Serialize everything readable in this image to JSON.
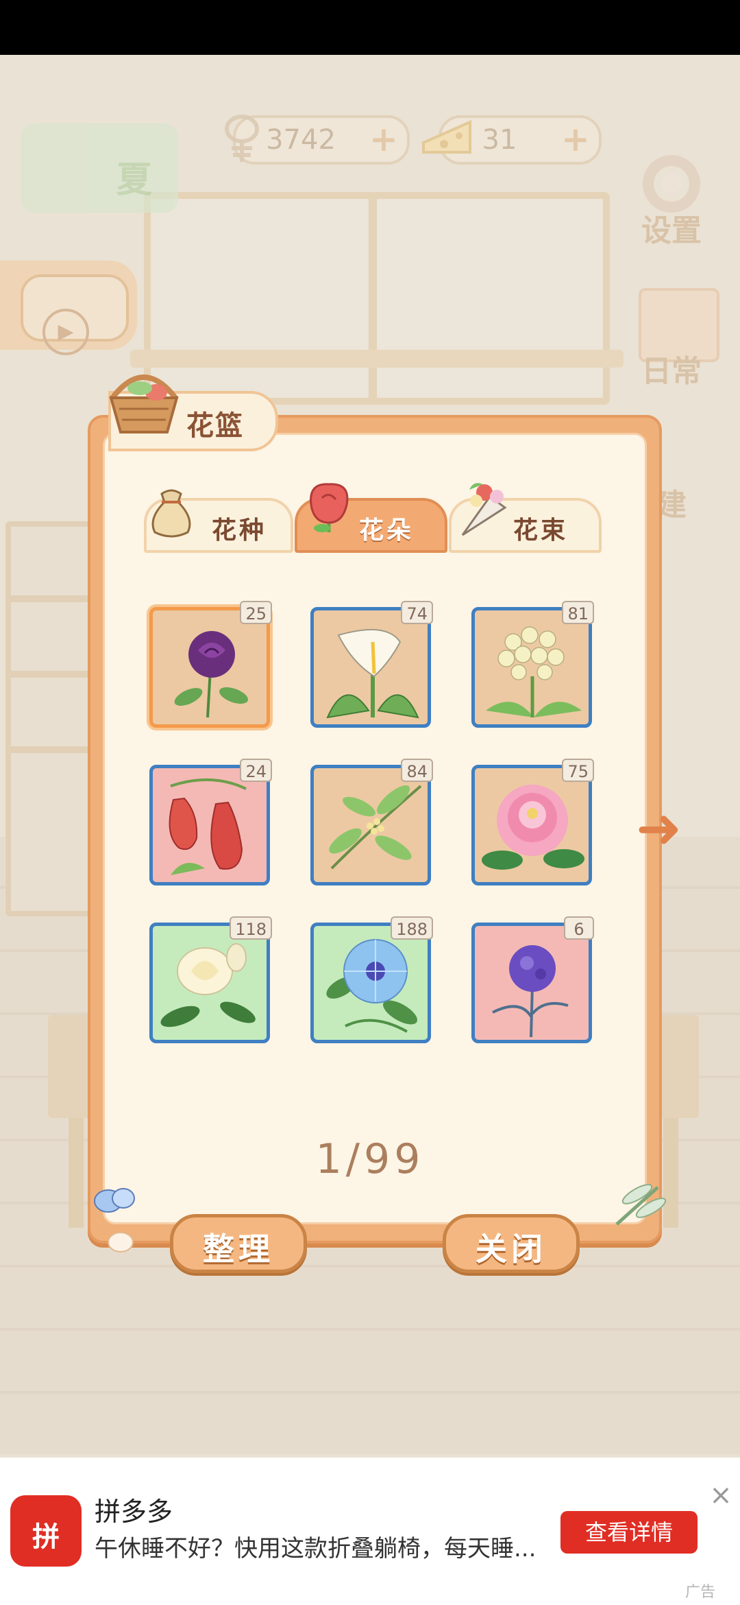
{
  "hud": {
    "season_label": "夏",
    "fish_count": "3742",
    "cheese_count": "31",
    "plus_label": "+",
    "settings_label": "设置",
    "daily_label": "日常",
    "build_label": "建"
  },
  "panel": {
    "title": "花篮",
    "tabs": [
      {
        "label": "花种",
        "active": false
      },
      {
        "label": "花朵",
        "active": true
      },
      {
        "label": "花束",
        "active": false
      }
    ],
    "items": [
      {
        "name": "purple-rose",
        "count": "25",
        "bg": "#ecc9a3",
        "selected": true
      },
      {
        "name": "calla-lily",
        "count": "74",
        "bg": "#ecc9a3",
        "selected": false
      },
      {
        "name": "white-flower-cluster",
        "count": "81",
        "bg": "#ecc9a3",
        "selected": false
      },
      {
        "name": "red-bell-flower",
        "count": "24",
        "bg": "#f4b9b4",
        "selected": false
      },
      {
        "name": "osmanthus",
        "count": "84",
        "bg": "#ecc9a3",
        "selected": false
      },
      {
        "name": "peony",
        "count": "75",
        "bg": "#ecc9a3",
        "selected": false
      },
      {
        "name": "gardenia",
        "count": "118",
        "bg": "#c5ebbd",
        "selected": false
      },
      {
        "name": "morning-glory",
        "count": "188",
        "bg": "#c5ebbd",
        "selected": false
      },
      {
        "name": "globe-thistle",
        "count": "6",
        "bg": "#f4b9b4",
        "selected": false
      }
    ],
    "pager": "1/99",
    "sort_label": "整理",
    "close_label": "关闭",
    "next_arrow": "➜"
  },
  "ad": {
    "app_name": "拼多多",
    "logo_text": "拼",
    "description": "午休睡不好？快用这款折叠躺椅，每天睡...",
    "cta_label": "查看详情",
    "close_icon": "×",
    "tag": "广告"
  }
}
